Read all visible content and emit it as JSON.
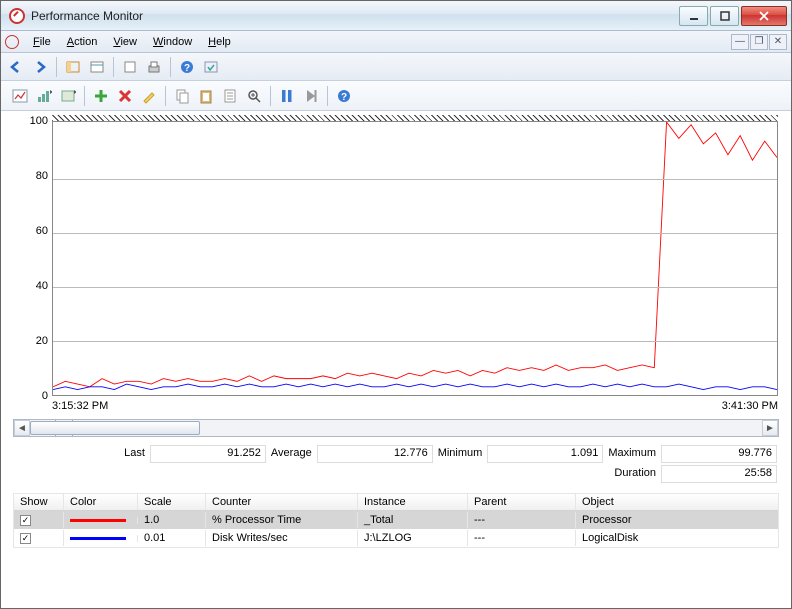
{
  "window": {
    "title": "Performance Monitor"
  },
  "menus": {
    "file": "File",
    "action": "Action",
    "view": "View",
    "window": "Window",
    "help": "Help"
  },
  "chart_data": {
    "type": "line",
    "ylim": [
      0,
      100
    ],
    "yticks": [
      0,
      20,
      40,
      60,
      80,
      100
    ],
    "xrange": [
      "3:15:32 PM",
      "3:41:30 PM"
    ],
    "series": [
      {
        "name": "% Processor Time",
        "color": "#ff0000",
        "values": [
          3,
          5,
          4,
          3,
          6,
          4,
          5,
          5,
          4,
          6,
          5,
          6,
          5,
          5,
          6,
          5,
          7,
          5,
          7,
          6,
          6,
          6,
          7,
          6,
          8,
          7,
          8,
          7,
          6,
          8,
          7,
          9,
          8,
          9,
          7,
          9,
          8,
          10,
          9,
          10,
          9,
          11,
          9,
          10,
          10,
          11,
          9,
          10,
          11,
          10,
          100,
          94,
          99,
          92,
          96,
          88,
          95,
          86,
          93,
          87
        ]
      },
      {
        "name": "Disk Writes/sec",
        "color": "#0000ff",
        "values": [
          2,
          3,
          2,
          3,
          3,
          2,
          4,
          3,
          2,
          3,
          3,
          4,
          3,
          3,
          4,
          3,
          4,
          3,
          3,
          4,
          3,
          4,
          3,
          4,
          3,
          4,
          3,
          3,
          4,
          3,
          4,
          3,
          4,
          3,
          4,
          3,
          3,
          4,
          3,
          4,
          3,
          4,
          3,
          3,
          4,
          3,
          4,
          3,
          4,
          3,
          3,
          4,
          3,
          2,
          3,
          3,
          2,
          3,
          3,
          2
        ]
      }
    ]
  },
  "stats": {
    "last_label": "Last",
    "last": "91.252",
    "average_label": "Average",
    "average": "12.776",
    "minimum_label": "Minimum",
    "minimum": "1.091",
    "maximum_label": "Maximum",
    "maximum": "99.776",
    "duration_label": "Duration",
    "duration": "25:58"
  },
  "counter_table": {
    "headers": {
      "show": "Show",
      "color": "Color",
      "scale": "Scale",
      "counter": "Counter",
      "instance": "Instance",
      "parent": "Parent",
      "object": "Object"
    },
    "rows": [
      {
        "checked": true,
        "color": "#ff0000",
        "scale": "1.0",
        "counter": "% Processor Time",
        "instance": "_Total",
        "parent": "---",
        "object": "Processor",
        "selected": true
      },
      {
        "checked": true,
        "color": "#0000ff",
        "scale": "0.01",
        "counter": "Disk Writes/sec",
        "instance": "J:\\LZLOG",
        "parent": "---",
        "object": "LogicalDisk",
        "selected": false
      }
    ]
  }
}
